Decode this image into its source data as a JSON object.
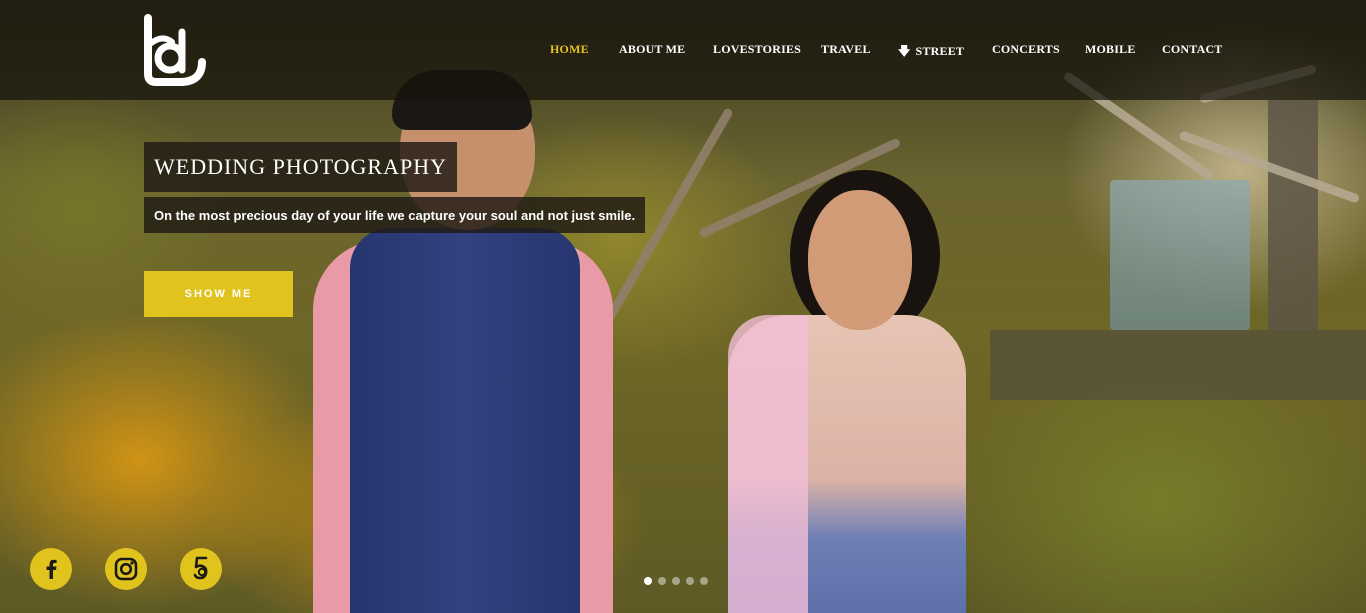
{
  "brand": {
    "logo_icon": "kd-monogram-logo",
    "logo_color": "#ffffff"
  },
  "nav": {
    "items": [
      {
        "label": "HOME",
        "active": true
      },
      {
        "label": "ABOUT ME",
        "active": false
      },
      {
        "label": "LOVESTORIES",
        "active": false
      },
      {
        "label": "TRAVEL",
        "active": false
      },
      {
        "label": "STREET",
        "active": false,
        "icon": "arrow-down-icon"
      },
      {
        "label": "CONCERTS",
        "active": false
      },
      {
        "label": "MOBILE",
        "active": false
      },
      {
        "label": "CONTACT",
        "active": false
      }
    ]
  },
  "slide": {
    "title": "WEDDING PHOTOGRAPHY",
    "subtitle": "On the most precious day of your life we capture your soul and not just smile.",
    "cta_label": "SHOW ME",
    "active_index": 0,
    "total": 5
  },
  "social": [
    {
      "name": "facebook-icon"
    },
    {
      "name": "instagram-icon"
    },
    {
      "name": "500px-icon"
    }
  ],
  "colors": {
    "accent": "#e1c31e",
    "header_bg": "#16140c",
    "text": "#ffffff"
  }
}
